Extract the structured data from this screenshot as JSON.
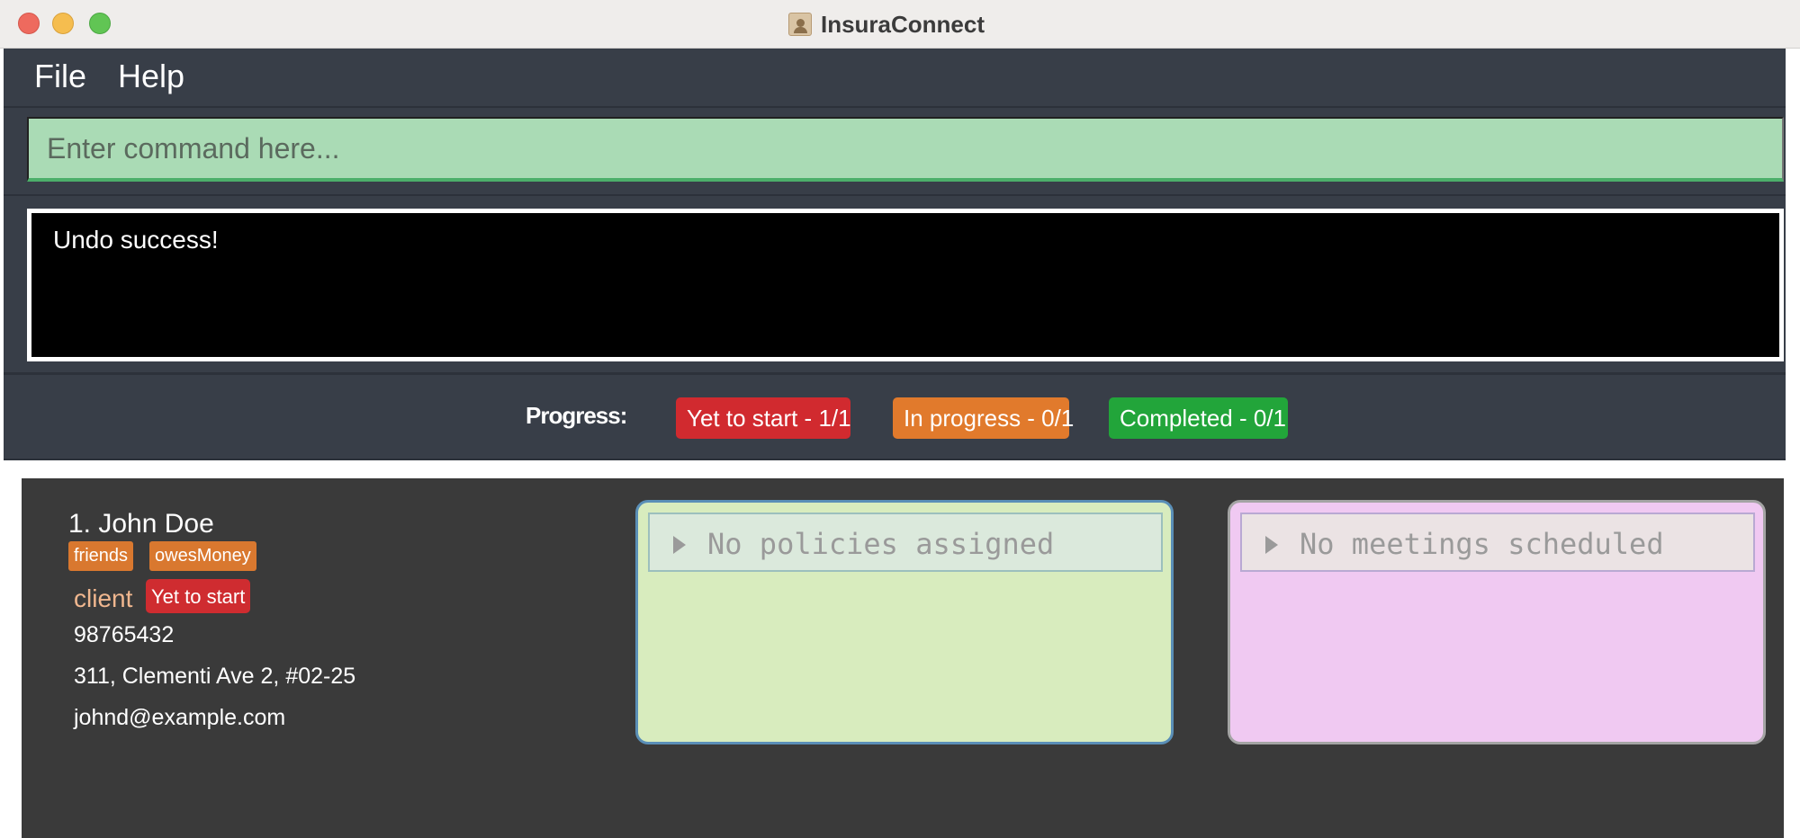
{
  "window": {
    "title": "InsuraConnect",
    "icon": "address-book-icon"
  },
  "menu": {
    "file_label": "File",
    "help_label": "Help"
  },
  "command": {
    "placeholder": "Enter command here...",
    "value": ""
  },
  "result": {
    "message": "Undo success!"
  },
  "progress": {
    "label": "Progress:",
    "yet_to_start": "Yet to start - 1/1",
    "in_progress": "In progress - 0/1",
    "completed": "Completed - 0/1",
    "colors": {
      "yet_to_start": "#d12a2f",
      "in_progress": "#e17a2c",
      "completed": "#22a53a"
    }
  },
  "clients": [
    {
      "index_name": "1.  John Doe",
      "tags": [
        "friends",
        "owesMoney"
      ],
      "role": "client",
      "status": "Yet to start",
      "phone": "98765432",
      "address": "311, Clementi Ave 2, #02-25",
      "email": "johnd@example.com",
      "policies_label": "No policies assigned",
      "meetings_label": "No meetings scheduled"
    }
  ]
}
